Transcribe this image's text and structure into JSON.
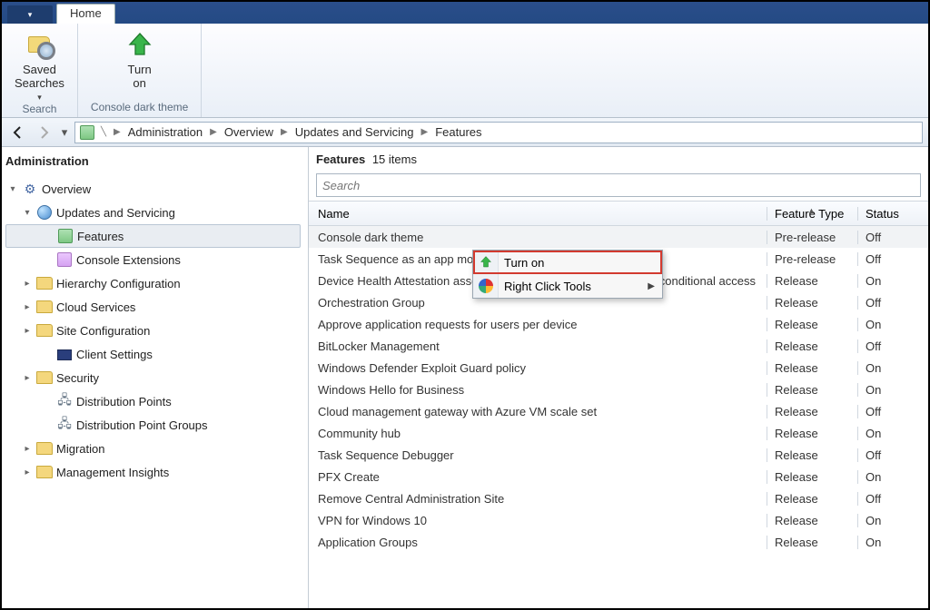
{
  "tab": {
    "home": "Home"
  },
  "ribbon": {
    "saved_searches_label": "Saved\nSearches",
    "saved_searches_group": "Search",
    "turn_on_label": "Turn\non",
    "dark_theme_group": "Console dark theme"
  },
  "breadcrumb": {
    "items": [
      "Administration",
      "Overview",
      "Updates and Servicing",
      "Features"
    ]
  },
  "tree": {
    "title": "Administration",
    "overview": "Overview",
    "updates": "Updates and Servicing",
    "features": "Features",
    "console_ext": "Console Extensions",
    "hierarchy": "Hierarchy Configuration",
    "cloud": "Cloud Services",
    "siteconf": "Site Configuration",
    "client": "Client Settings",
    "security": "Security",
    "distpoints": "Distribution Points",
    "distgroups": "Distribution Point Groups",
    "migration": "Migration",
    "insights": "Management Insights"
  },
  "content": {
    "title_label": "Features",
    "count_label": "15 items",
    "search_placeholder": "Search",
    "col_name": "Name",
    "col_type": "Feature Type",
    "col_status": "Status",
    "rows": [
      {
        "name": "Console dark theme",
        "type": "Pre-release",
        "status": "Off"
      },
      {
        "name": "Task Sequence as an app mod",
        "type": "Pre-release",
        "status": "Off"
      },
      {
        "name": "Device Health Attestation assessment for compliance policies for conditional access",
        "type": "Release",
        "status": "On"
      },
      {
        "name": "Orchestration Group",
        "type": "Release",
        "status": "Off"
      },
      {
        "name": "Approve application requests for users per device",
        "type": "Release",
        "status": "On"
      },
      {
        "name": "BitLocker Management",
        "type": "Release",
        "status": "Off"
      },
      {
        "name": "Windows Defender Exploit Guard policy",
        "type": "Release",
        "status": "On"
      },
      {
        "name": "Windows Hello for Business",
        "type": "Release",
        "status": "On"
      },
      {
        "name": "Cloud management gateway with Azure VM scale set",
        "type": "Release",
        "status": "Off"
      },
      {
        "name": "Community hub",
        "type": "Release",
        "status": "On"
      },
      {
        "name": "Task Sequence Debugger",
        "type": "Release",
        "status": "Off"
      },
      {
        "name": "PFX Create",
        "type": "Release",
        "status": "On"
      },
      {
        "name": "Remove Central Administration Site",
        "type": "Release",
        "status": "Off"
      },
      {
        "name": "VPN for Windows 10",
        "type": "Release",
        "status": "On"
      },
      {
        "name": "Application Groups",
        "type": "Release",
        "status": "On"
      }
    ]
  },
  "context_menu": {
    "turn_on": "Turn on",
    "right_click_tools": "Right Click Tools"
  }
}
